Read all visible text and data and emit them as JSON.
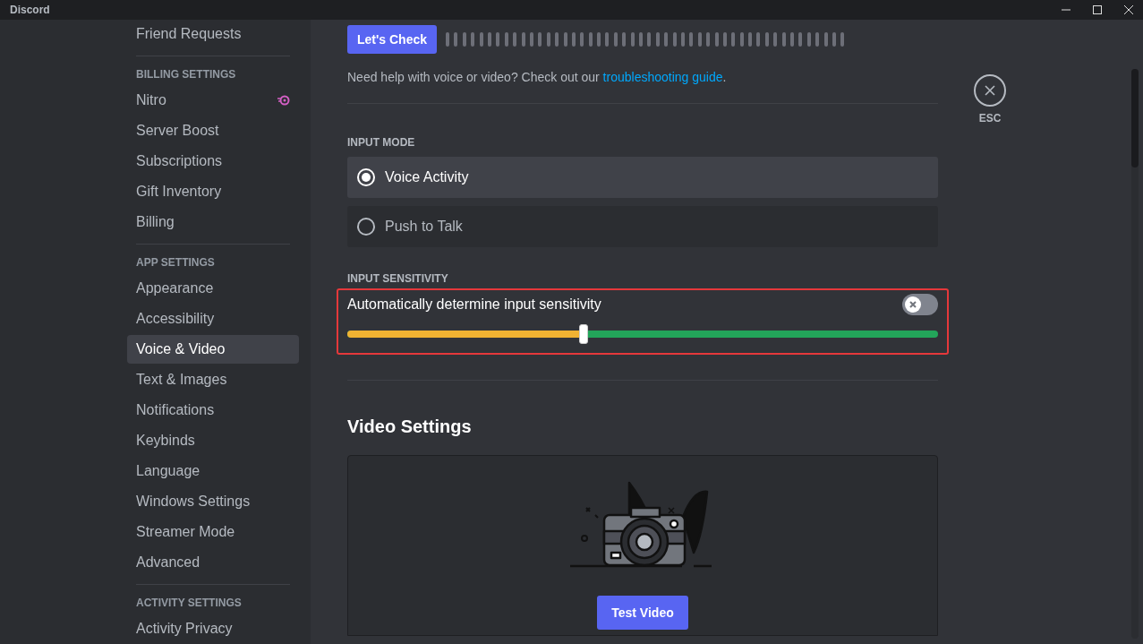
{
  "window": {
    "title": "Discord"
  },
  "sidebar": {
    "sections": [
      {
        "items": [
          {
            "label": "Friend Requests",
            "kind": "plain",
            "selected": false
          }
        ]
      },
      {
        "header": "BILLING SETTINGS",
        "items": [
          {
            "label": "Nitro",
            "kind": "nitro",
            "selected": false
          },
          {
            "label": "Server Boost",
            "kind": "plain",
            "selected": false
          },
          {
            "label": "Subscriptions",
            "kind": "plain",
            "selected": false
          },
          {
            "label": "Gift Inventory",
            "kind": "plain",
            "selected": false
          },
          {
            "label": "Billing",
            "kind": "plain",
            "selected": false
          }
        ]
      },
      {
        "header": "APP SETTINGS",
        "items": [
          {
            "label": "Appearance",
            "kind": "plain",
            "selected": false
          },
          {
            "label": "Accessibility",
            "kind": "plain",
            "selected": false
          },
          {
            "label": "Voice & Video",
            "kind": "plain",
            "selected": true
          },
          {
            "label": "Text & Images",
            "kind": "plain",
            "selected": false
          },
          {
            "label": "Notifications",
            "kind": "plain",
            "selected": false
          },
          {
            "label": "Keybinds",
            "kind": "plain",
            "selected": false
          },
          {
            "label": "Language",
            "kind": "plain",
            "selected": false
          },
          {
            "label": "Windows Settings",
            "kind": "plain",
            "selected": false
          },
          {
            "label": "Streamer Mode",
            "kind": "plain",
            "selected": false
          },
          {
            "label": "Advanced",
            "kind": "plain",
            "selected": false
          }
        ]
      },
      {
        "header": "ACTIVITY SETTINGS",
        "items": [
          {
            "label": "Activity Privacy",
            "kind": "plain",
            "selected": false
          }
        ]
      }
    ]
  },
  "content": {
    "mic_test_button": "Let's Check",
    "help": {
      "text": "Need help with voice or video? Check out our ",
      "link": "troubleshooting guide",
      "end": "."
    },
    "input_mode": {
      "header": "INPUT MODE",
      "options": [
        {
          "label": "Voice Activity",
          "selected": true
        },
        {
          "label": "Push to Talk",
          "selected": false
        }
      ]
    },
    "input_sensitivity": {
      "header": "INPUT SENSITIVITY",
      "auto_label": "Automatically determine input sensitivity",
      "auto_on": false,
      "level": 0.4
    },
    "video_settings": {
      "title": "Video Settings",
      "test_button": "Test Video"
    }
  },
  "close": {
    "label": "ESC"
  }
}
